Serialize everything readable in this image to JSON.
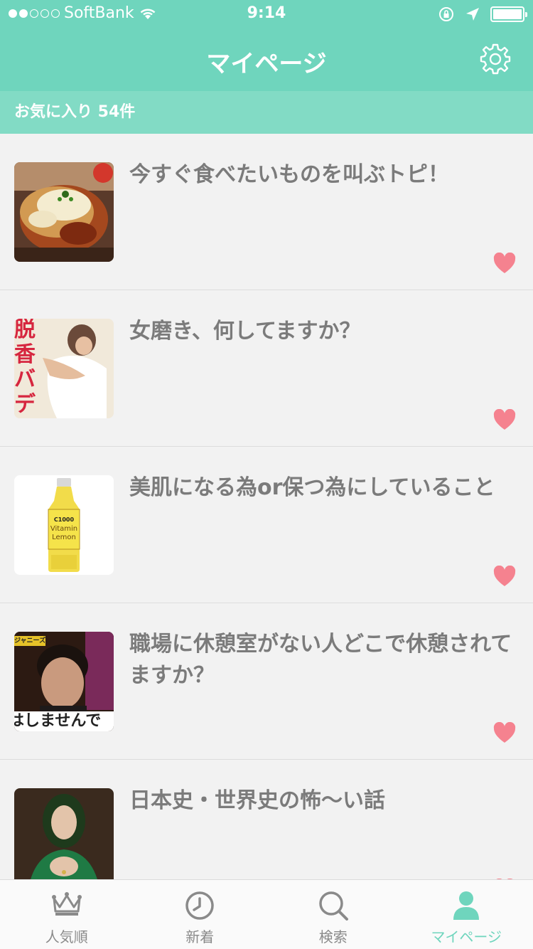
{
  "status_bar": {
    "carrier": "SoftBank",
    "time": "9:14",
    "signal_bars_filled": 2,
    "signal_bars_total": 5
  },
  "header": {
    "title": "マイページ",
    "settings_icon": "gear-icon"
  },
  "favorites": {
    "label": "お気に入り 54件"
  },
  "items": [
    {
      "title": "今すぐ食べたいものを叫ぶトピ！",
      "favorited": true
    },
    {
      "title": "女磨き、何してますか？",
      "favorited": true
    },
    {
      "title": "美肌になる為or保つ為にしていること",
      "favorited": true
    },
    {
      "title": "職場に休憩室がない人どこで休憩されてますか？",
      "favorited": true
    },
    {
      "title": "日本史・世界史の怖〜い話",
      "favorited": true
    }
  ],
  "thumb_text": {
    "magazine": "脱 香 バ デ ィ",
    "bottle_brand": "C1000",
    "bottle_name": "Vitamin Lemon",
    "tv_tag": "ジャニーズ",
    "tv_caption": "はしませんで"
  },
  "tabs": [
    {
      "label": "人気順",
      "icon": "crown-icon",
      "active": false
    },
    {
      "label": "新着",
      "icon": "clock-icon",
      "active": false
    },
    {
      "label": "検索",
      "icon": "search-icon",
      "active": false
    },
    {
      "label": "マイページ",
      "icon": "person-icon",
      "active": true
    }
  ],
  "colors": {
    "accent": "#6fd5bd",
    "heart": "#f5828f",
    "title_text": "#7b7b7b"
  }
}
